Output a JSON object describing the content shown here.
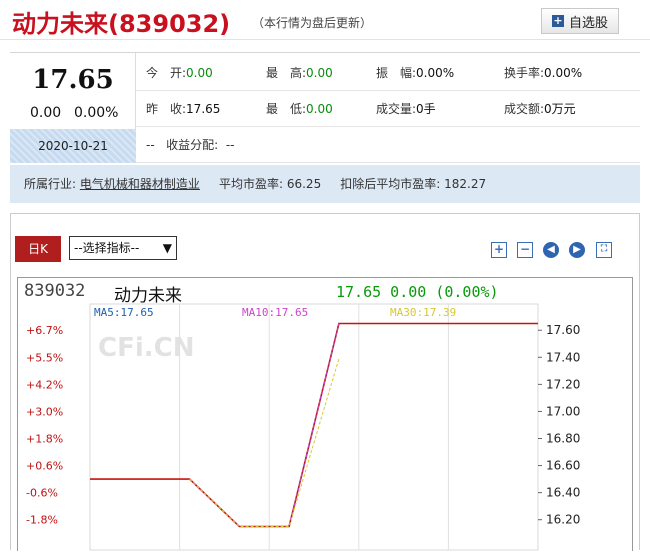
{
  "header": {
    "title": "动力未来(839032)",
    "note": "（本行情为盘后更新）",
    "fav_label": "自选股",
    "fav_icon": "plus-icon"
  },
  "quote": {
    "price": "17.65",
    "change": "0.00",
    "change_pct": "0.00%",
    "datetime": "2020-10-21 16:00:00",
    "row1": [
      {
        "label": "今　开:",
        "value": "0.00"
      },
      {
        "label": "最　高:",
        "value": "0.00"
      },
      {
        "label": "振　幅:",
        "value": "0.00%"
      },
      {
        "label": "换手率:",
        "value": "0.00%"
      }
    ],
    "row2": [
      {
        "label": "昨　收:",
        "value": "17.65"
      },
      {
        "label": "最　低:",
        "value": "0.00"
      },
      {
        "label": "成交量:",
        "value": "0手"
      },
      {
        "label": "成交额:",
        "value": "0万元"
      }
    ],
    "row3_prefix": "--",
    "row3_label": "收益分配:",
    "row3_value": "--"
  },
  "industry": {
    "label": "所属行业:",
    "value": "电气机械和器材制造业",
    "pe_label": "平均市盈率:",
    "pe_value": "66.25",
    "pe2_label": "扣除后平均市盈率:",
    "pe2_value": "182.27"
  },
  "chart_panel": {
    "tab_label": "日K",
    "select_label": "--选择指标--",
    "tools": [
      "zoom-in-icon",
      "zoom-out-icon",
      "pan-left-icon",
      "pan-right-icon",
      "fullscreen-icon"
    ],
    "code": "839032",
    "name": "动力未来",
    "quote_text": "17.65 0.00 (0.00%)",
    "watermark": "CFi.CN"
  },
  "chart_data": {
    "type": "line",
    "ylim": [
      16.05,
      17.72
    ],
    "right_ticks": [
      "17.60",
      "17.40",
      "17.20",
      "17.00",
      "16.80",
      "16.60",
      "16.40",
      "16.20"
    ],
    "right_tick_values": [
      17.6,
      17.4,
      17.2,
      17.0,
      16.8,
      16.6,
      16.4,
      16.2
    ],
    "left_ticks": [
      "+6.7%",
      "+5.5%",
      "+4.2%",
      "+3.0%",
      "+1.8%",
      "+0.6%",
      "-0.6%",
      "-1.8%"
    ],
    "legend": [
      {
        "label": "MA5:17.65",
        "color": "#1f5fb0"
      },
      {
        "label": "MA10:17.65",
        "color": "#cc44cc"
      },
      {
        "label": "MA30:17.39",
        "color": "#d8c830"
      }
    ],
    "price_color": "#cc1111",
    "x": [
      0,
      1,
      2,
      3,
      4,
      5,
      6,
      7,
      8,
      9
    ],
    "series": [
      {
        "name": "price",
        "values": [
          16.5,
          16.5,
          16.5,
          16.15,
          16.15,
          17.65,
          17.65,
          17.65,
          17.65,
          17.65
        ]
      },
      {
        "name": "MA5",
        "values": [
          null,
          null,
          16.5,
          16.15,
          16.15,
          17.65,
          null,
          null,
          null,
          null
        ]
      },
      {
        "name": "MA10",
        "values": [
          null,
          null,
          16.5,
          16.15,
          16.15,
          17.65,
          null,
          null,
          null,
          null
        ]
      },
      {
        "name": "MA30",
        "values": [
          null,
          null,
          16.5,
          16.15,
          16.15,
          17.39,
          null,
          null,
          null,
          null
        ]
      }
    ]
  }
}
